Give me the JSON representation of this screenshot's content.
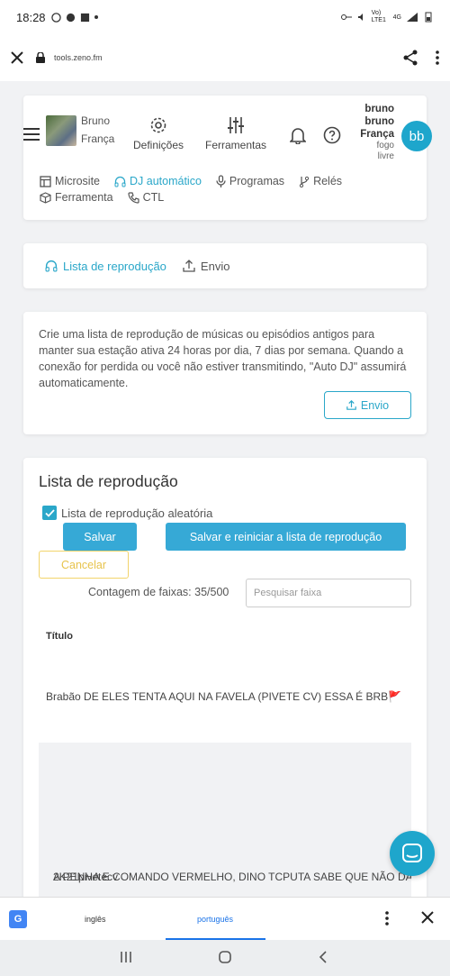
{
  "status_bar": {
    "time": "18:28",
    "network": "Vo) LTE1",
    "signal": "4G"
  },
  "browser": {
    "url": "tools.zeno.fm"
  },
  "nav": {
    "user_first": "Bruno",
    "user_last": "França",
    "settings_label": "Definições",
    "tools_label": "Ferramentas",
    "profile_name_lines": [
      "bruno",
      "bruno",
      "França"
    ],
    "profile_sub_lines": [
      "fogo",
      "livre"
    ],
    "avatar_initials": "bb",
    "subnav": {
      "microsite": "Microsite",
      "autodj": "DJ automático",
      "programs": "Programas",
      "relays": "Relés",
      "tool": "Ferramenta",
      "ctl": "CTL"
    }
  },
  "tabs": {
    "playlist": "Lista de reprodução",
    "upload": "Envio"
  },
  "info": {
    "text": "Crie uma lista de reprodução de músicas ou episódios antigos para manter sua estação ativa 24 horas por dia, 7 dias por semana. Quando a conexão for perdida ou você não estiver transmitindo, \"Auto DJ\" assumirá automaticamente.",
    "upload_button": "Envio"
  },
  "playlist": {
    "title": "Lista de reprodução",
    "shuffle_label": "Lista de reprodução aleatória",
    "shuffle_checked": true,
    "save_button": "Salvar",
    "save_restart_button": "Salvar e reiniciar a lista de reprodução",
    "cancel_button": "Cancelar",
    "track_count": "Contagem de faixas: 35/500",
    "search_placeholder": "Pesquisar faixa",
    "column_title": "Título",
    "tracks": [
      {
        "title": "Brabão DE ELES TENTA AQUI NA FAVELA (PIVETE CV) ESSA É BRB🚩"
      },
      {
        "title_line1": "A PENHA E COMANDO VERMELHO, DINO TCPUTA SABE QUE NÃO DÁ",
        "title_line2": "2K21pivetecv"
      }
    ]
  },
  "translate_bar": {
    "lang_from": "inglês",
    "lang_to": "português"
  },
  "colors": {
    "accent": "#2aa7c9",
    "button_blue": "#36a9d6",
    "cancel_yellow": "#e7c34b"
  }
}
